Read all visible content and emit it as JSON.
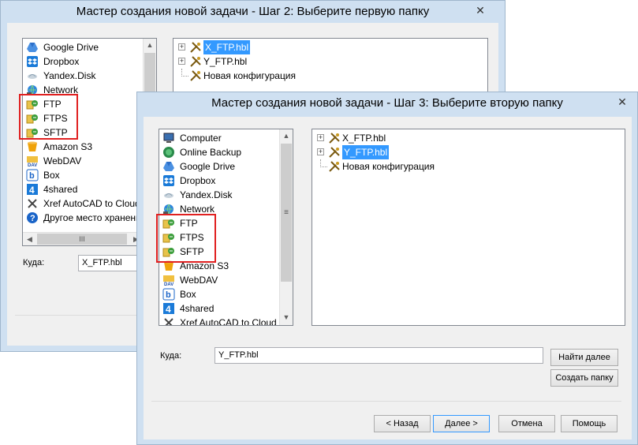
{
  "win1": {
    "title": "Мастер создания новой задачи - Шаг 2: Выберите первую папку",
    "close": "✕",
    "items": [
      {
        "label": "Google Drive",
        "icon": "google-drive-icon"
      },
      {
        "label": "Dropbox",
        "icon": "dropbox-icon"
      },
      {
        "label": "Yandex.Disk",
        "icon": "yandex-disk-icon"
      },
      {
        "label": "Network",
        "icon": "network-icon"
      },
      {
        "label": "FTP",
        "icon": "ftp-icon"
      },
      {
        "label": "FTPS",
        "icon": "ftps-icon"
      },
      {
        "label": "SFTP",
        "icon": "sftp-icon"
      },
      {
        "label": "Amazon S3",
        "icon": "amazon-s3-icon"
      },
      {
        "label": "WebDAV",
        "icon": "webdav-icon"
      },
      {
        "label": "Box",
        "icon": "box-icon"
      },
      {
        "label": "4shared",
        "icon": "4shared-icon"
      },
      {
        "label": "Xref AutoCAD to Cloud",
        "icon": "xref-icon"
      },
      {
        "label": "Другое место хранения",
        "icon": "help-icon"
      }
    ],
    "tree": [
      {
        "label": "X_FTP.hbl",
        "selected": true,
        "expander": "+"
      },
      {
        "label": "Y_FTP.hbl",
        "selected": false,
        "expander": "+"
      },
      {
        "label": "Новая конфигурация",
        "selected": false,
        "expander": ""
      }
    ],
    "dest_label": "Куда:",
    "dest_value": "X_FTP.hbl",
    "hscroll_mid": "III"
  },
  "win2": {
    "title": "Мастер создания новой задачи - Шаг 3: Выберите вторую папку",
    "close": "✕",
    "items": [
      {
        "label": "Computer",
        "icon": "computer-icon"
      },
      {
        "label": "Online Backup",
        "icon": "online-backup-icon"
      },
      {
        "label": "Google Drive",
        "icon": "google-drive-icon"
      },
      {
        "label": "Dropbox",
        "icon": "dropbox-icon"
      },
      {
        "label": "Yandex.Disk",
        "icon": "yandex-disk-icon"
      },
      {
        "label": "Network",
        "icon": "network-icon"
      },
      {
        "label": "FTP",
        "icon": "ftp-icon"
      },
      {
        "label": "FTPS",
        "icon": "ftps-icon"
      },
      {
        "label": "SFTP",
        "icon": "sftp-icon"
      },
      {
        "label": "Amazon S3",
        "icon": "amazon-s3-icon"
      },
      {
        "label": "WebDAV",
        "icon": "webdav-icon"
      },
      {
        "label": "Box",
        "icon": "box-icon"
      },
      {
        "label": "4shared",
        "icon": "4shared-icon"
      },
      {
        "label": "Xref AutoCAD to Cloud",
        "icon": "xref-icon"
      }
    ],
    "tree": [
      {
        "label": "X_FTP.hbl",
        "selected": false,
        "expander": "+"
      },
      {
        "label": "Y_FTP.hbl",
        "selected": true,
        "expander": "+"
      },
      {
        "label": "Новая конфигурация",
        "selected": false,
        "expander": ""
      }
    ],
    "dest_label": "Куда:",
    "dest_value": "Y_FTP.hbl",
    "find_next": "Найти далее",
    "create_folder": "Создать папку",
    "back": "< Назад",
    "next": "Далее >",
    "cancel": "Отмена",
    "help": "Помощь",
    "vscroll_mid": "≡"
  },
  "colors": {
    "selection": "#3399ff",
    "highlight_box": "#e02020",
    "frame": "#cfe0f1"
  }
}
